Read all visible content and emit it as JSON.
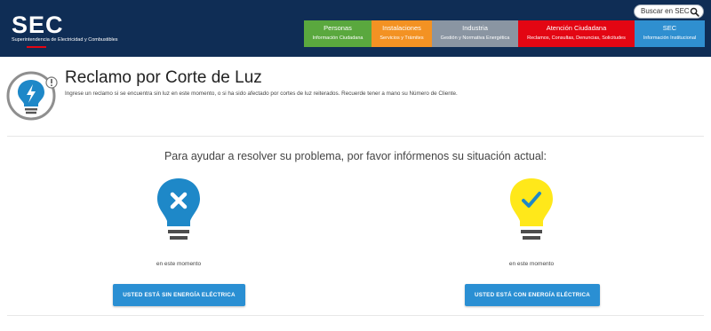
{
  "header": {
    "logo_text": "SEC",
    "logo_subtitle": "Superintendencia de Electricidad y Combustibles",
    "search_label": "Buscar en SEC",
    "nav": [
      {
        "title": "Personas",
        "subtitle": "Información Ciudadana",
        "color": "#5aa83e"
      },
      {
        "title": "Instalaciones",
        "subtitle": "Servicios y Trámites",
        "color": "#f39223"
      },
      {
        "title": "Industria",
        "subtitle": "Gestión y Normativa Energética",
        "color": "#8a95a2"
      },
      {
        "title": "Atención Ciudadana",
        "subtitle": "Reclamos, Consultas, Denuncias, Solicitudes",
        "color": "#e30613"
      },
      {
        "title": "SEC",
        "subtitle": "Información Institucional",
        "color": "#2f8fd0"
      }
    ]
  },
  "page": {
    "title": "Reclamo por Corte de Luz",
    "description": "Ingrese un reclamo si se encuentra sin luz en este momento, o si ha sido afectado por cortes de luz reiterados. Recuerde tener a mano su Número de Cliente.",
    "question": "Para ayudar a resolver su problema, por favor infórmenos su situación actual:"
  },
  "options": [
    {
      "icon": "bulb-off-icon",
      "mark": "x",
      "caption": "en este momento",
      "button": "USTED ESTÁ SIN ENERGÍA ELÉCTRICA",
      "color": "#1e88c8"
    },
    {
      "icon": "bulb-on-icon",
      "caption": "en este momento",
      "button": "USTED ESTÁ CON ENERGÍA ELÉCTRICA",
      "color": "#ffe81a"
    }
  ],
  "colors": {
    "header_bg": "#0f2d55",
    "button": "#2a8fd3",
    "accent_red": "#e30613"
  }
}
